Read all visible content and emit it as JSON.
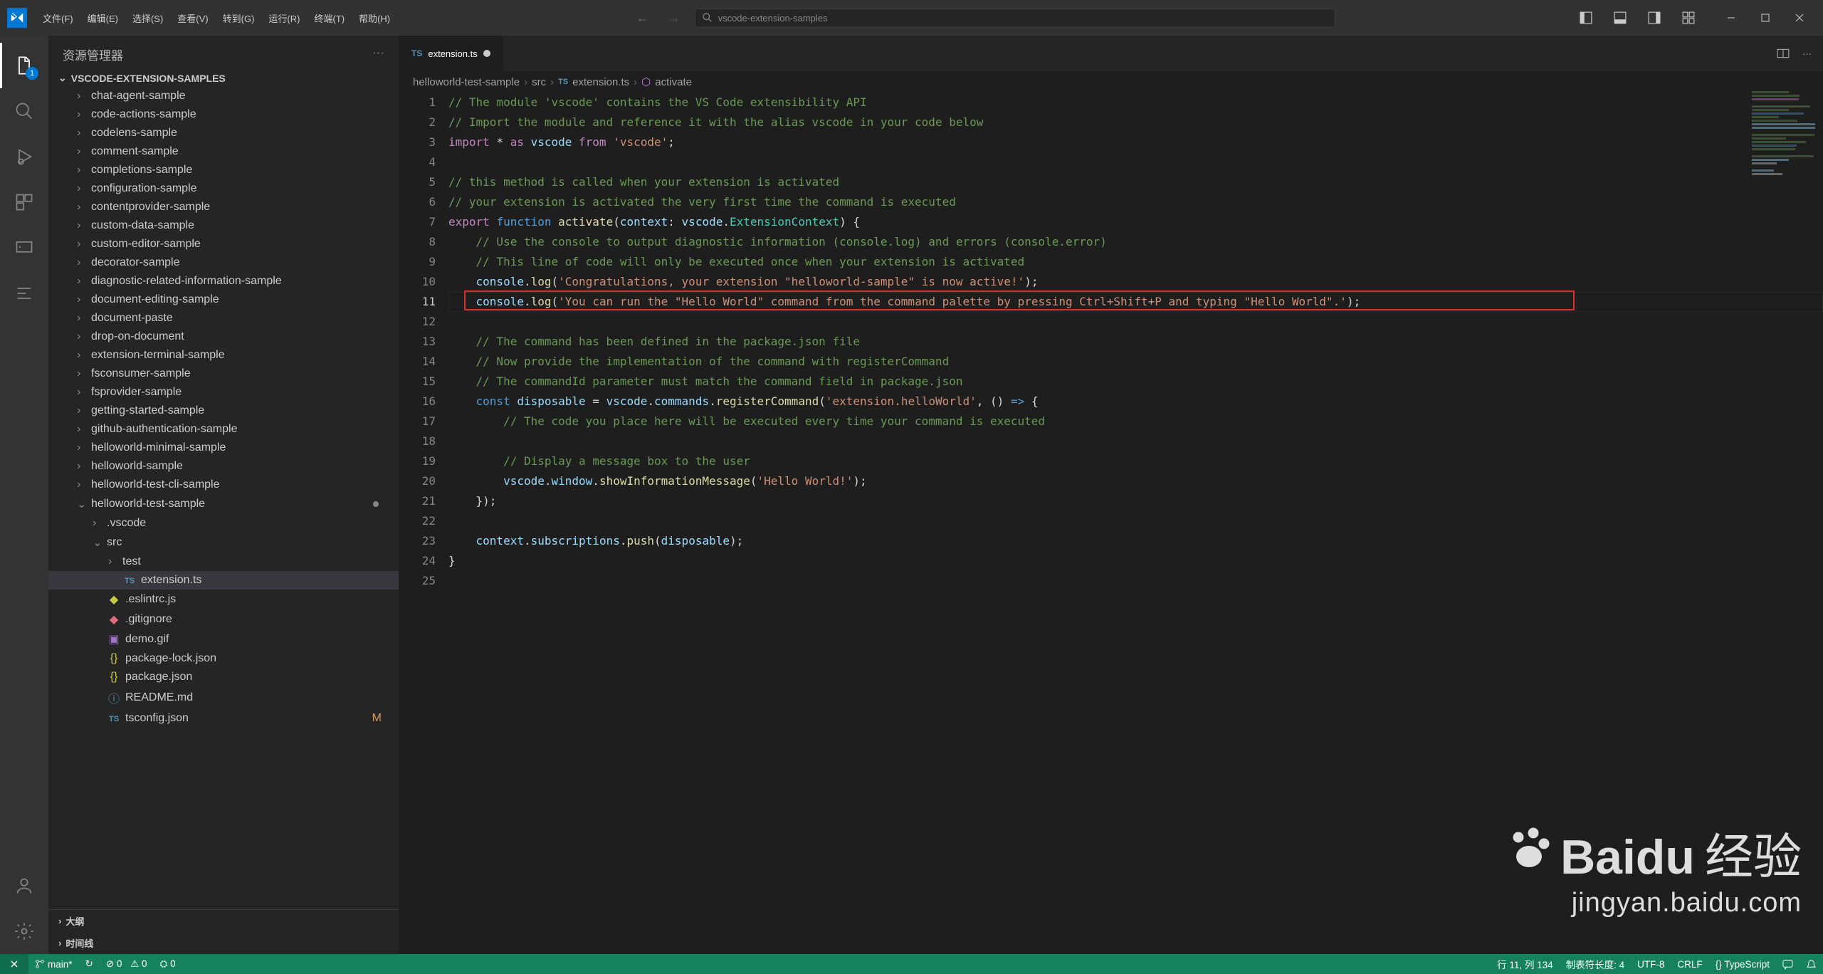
{
  "menu": [
    "文件(F)",
    "编辑(E)",
    "选择(S)",
    "查看(V)",
    "转到(G)",
    "运行(R)",
    "终端(T)",
    "帮助(H)"
  ],
  "search_placeholder": "vscode-extension-samples",
  "explorer": {
    "title": "资源管理器",
    "section": "VSCODE-EXTENSION-SAMPLES",
    "outline": "大纲",
    "timeline": "时间线",
    "folders": [
      "chat-agent-sample",
      "code-actions-sample",
      "codelens-sample",
      "comment-sample",
      "completions-sample",
      "configuration-sample",
      "contentprovider-sample",
      "custom-data-sample",
      "custom-editor-sample",
      "decorator-sample",
      "diagnostic-related-information-sample",
      "document-editing-sample",
      "document-paste",
      "drop-on-document",
      "extension-terminal-sample",
      "fsconsumer-sample",
      "fsprovider-sample",
      "getting-started-sample",
      "github-authentication-sample",
      "helloworld-minimal-sample",
      "helloworld-sample",
      "helloworld-test-cli-sample"
    ],
    "open_folder": "helloworld-test-sample",
    "subfolders": [
      ".vscode",
      "src"
    ],
    "test_folder": "test",
    "open_file": "extension.ts",
    "files": [
      {
        "icon": "js",
        "name": ".eslintrc.js"
      },
      {
        "icon": "git",
        "name": ".gitignore"
      },
      {
        "icon": "img",
        "name": "demo.gif"
      },
      {
        "icon": "json",
        "name": "package-lock.json"
      },
      {
        "icon": "json",
        "name": "package.json"
      },
      {
        "icon": "md",
        "name": "README.md"
      },
      {
        "icon": "ts",
        "name": "tsconfig.json",
        "modified": "M"
      }
    ]
  },
  "tab": {
    "icon": "TS",
    "label": "extension.ts"
  },
  "breadcrumb": [
    "helloworld-test-sample",
    "src",
    "extension.ts",
    "activate"
  ],
  "code": {
    "lines": [
      [
        [
          "c-comment",
          "// The module 'vscode' contains the VS Code extensibility API"
        ]
      ],
      [
        [
          "c-comment",
          "// Import the module and reference it with the alias vscode in your code below"
        ]
      ],
      [
        [
          "c-kw",
          "import"
        ],
        [
          "c-punc",
          " * "
        ],
        [
          "c-kw",
          "as"
        ],
        [
          "c-var",
          " vscode "
        ],
        [
          "c-kw",
          "from"
        ],
        [
          "c-str",
          " 'vscode'"
        ],
        [
          "c-punc",
          ";"
        ]
      ],
      [],
      [
        [
          "c-comment",
          "// this method is called when your extension is activated"
        ]
      ],
      [
        [
          "c-comment",
          "// your extension is activated the very first time the command is executed"
        ]
      ],
      [
        [
          "c-kw",
          "export"
        ],
        [
          "c-punc",
          " "
        ],
        [
          "c-kw2",
          "function"
        ],
        [
          "c-punc",
          " "
        ],
        [
          "c-func",
          "activate"
        ],
        [
          "c-punc",
          "("
        ],
        [
          "c-var",
          "context"
        ],
        [
          "c-punc",
          ": "
        ],
        [
          "c-var",
          "vscode"
        ],
        [
          "c-punc",
          "."
        ],
        [
          "c-type",
          "ExtensionContext"
        ],
        [
          "c-punc",
          ") "
        ],
        [
          "c-punc",
          "{"
        ]
      ],
      [
        [
          "c-punc",
          "    "
        ],
        [
          "c-comment",
          "// Use the console to output diagnostic information (console.log) and errors (console.error)"
        ]
      ],
      [
        [
          "c-punc",
          "    "
        ],
        [
          "c-comment",
          "// This line of code will only be executed once when your extension is activated"
        ]
      ],
      [
        [
          "c-punc",
          "    "
        ],
        [
          "c-var",
          "console"
        ],
        [
          "c-punc",
          "."
        ],
        [
          "c-func",
          "log"
        ],
        [
          "c-punc",
          "("
        ],
        [
          "c-str",
          "'Congratulations, your extension \"helloworld-sample\" is now active!'"
        ],
        [
          "c-punc",
          ");"
        ]
      ],
      [
        [
          "c-punc",
          "    "
        ],
        [
          "c-var",
          "console"
        ],
        [
          "c-punc",
          "."
        ],
        [
          "c-func",
          "log"
        ],
        [
          "c-punc",
          "("
        ],
        [
          "c-str",
          "'You can run the \"Hello World\" command from the command palette by pressing Ctrl+Shift+P and typing \"Hello World\".'"
        ],
        [
          "c-punc",
          ");"
        ]
      ],
      [],
      [
        [
          "c-punc",
          "    "
        ],
        [
          "c-comment",
          "// The command has been defined in the package.json file"
        ]
      ],
      [
        [
          "c-punc",
          "    "
        ],
        [
          "c-comment",
          "// Now provide the implementation of the command with registerCommand"
        ]
      ],
      [
        [
          "c-punc",
          "    "
        ],
        [
          "c-comment",
          "// The commandId parameter must match the command field in package.json"
        ]
      ],
      [
        [
          "c-punc",
          "    "
        ],
        [
          "c-kw2",
          "const"
        ],
        [
          "c-punc",
          " "
        ],
        [
          "c-var",
          "disposable"
        ],
        [
          "c-punc",
          " = "
        ],
        [
          "c-var",
          "vscode"
        ],
        [
          "c-punc",
          "."
        ],
        [
          "c-var",
          "commands"
        ],
        [
          "c-punc",
          "."
        ],
        [
          "c-func",
          "registerCommand"
        ],
        [
          "c-punc",
          "("
        ],
        [
          "c-str",
          "'extension.helloWorld'"
        ],
        [
          "c-punc",
          ", () "
        ],
        [
          "c-kw2",
          "=>"
        ],
        [
          "c-punc",
          " {"
        ]
      ],
      [
        [
          "c-punc",
          "        "
        ],
        [
          "c-comment",
          "// The code you place here will be executed every time your command is executed"
        ]
      ],
      [],
      [
        [
          "c-punc",
          "        "
        ],
        [
          "c-comment",
          "// Display a message box to the user"
        ]
      ],
      [
        [
          "c-punc",
          "        "
        ],
        [
          "c-var",
          "vscode"
        ],
        [
          "c-punc",
          "."
        ],
        [
          "c-var",
          "window"
        ],
        [
          "c-punc",
          "."
        ],
        [
          "c-func",
          "showInformationMessage"
        ],
        [
          "c-punc",
          "("
        ],
        [
          "c-str",
          "'Hello World!'"
        ],
        [
          "c-punc",
          ");"
        ]
      ],
      [
        [
          "c-punc",
          "    });"
        ]
      ],
      [],
      [
        [
          "c-punc",
          "    "
        ],
        [
          "c-var",
          "context"
        ],
        [
          "c-punc",
          "."
        ],
        [
          "c-var",
          "subscriptions"
        ],
        [
          "c-punc",
          "."
        ],
        [
          "c-func",
          "push"
        ],
        [
          "c-punc",
          "("
        ],
        [
          "c-var",
          "disposable"
        ],
        [
          "c-punc",
          ");"
        ]
      ],
      [
        [
          "c-punc",
          "}"
        ]
      ],
      []
    ]
  },
  "status": {
    "branch": "main*",
    "sync": "↻",
    "errors": "⊘ 0",
    "warnings": "⚠ 0",
    "ports": "⛭ 0",
    "ln_col": "行 11, 列 134",
    "tabsize": "制表符长度: 4",
    "encoding": "UTF-8",
    "eol": "CRLF",
    "lang": "{} TypeScript"
  },
  "watermark": {
    "main": "Baidu",
    "sub_cn": "经验",
    "url": "jingyan.baidu.com"
  }
}
